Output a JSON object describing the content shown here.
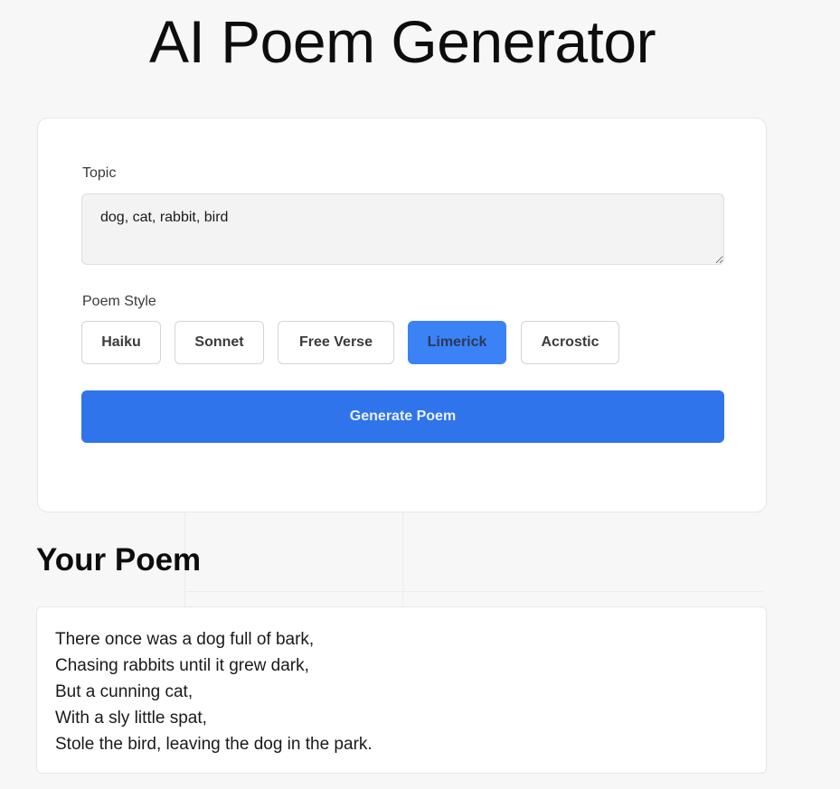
{
  "app": {
    "title": "AI Poem Generator"
  },
  "form": {
    "topic_label": "Topic",
    "topic_value": "dog, cat, rabbit, bird",
    "style_label": "Poem Style",
    "styles": [
      {
        "label": "Haiku",
        "selected": false
      },
      {
        "label": "Sonnet",
        "selected": false
      },
      {
        "label": "Free Verse",
        "selected": false
      },
      {
        "label": "Limerick",
        "selected": true
      },
      {
        "label": "Acrostic",
        "selected": false
      }
    ],
    "generate_label": "Generate Poem"
  },
  "result": {
    "heading": "Your Poem",
    "lines": [
      "There once was a dog full of bark,",
      "Chasing rabbits until it grew dark,",
      "But a cunning cat,",
      "With a sly little spat,",
      "Stole the bird, leaving the dog in the park."
    ]
  },
  "colors": {
    "accent": "#2f74eb",
    "selected_style": "#3b82f6",
    "background": "#f7f7f8"
  }
}
